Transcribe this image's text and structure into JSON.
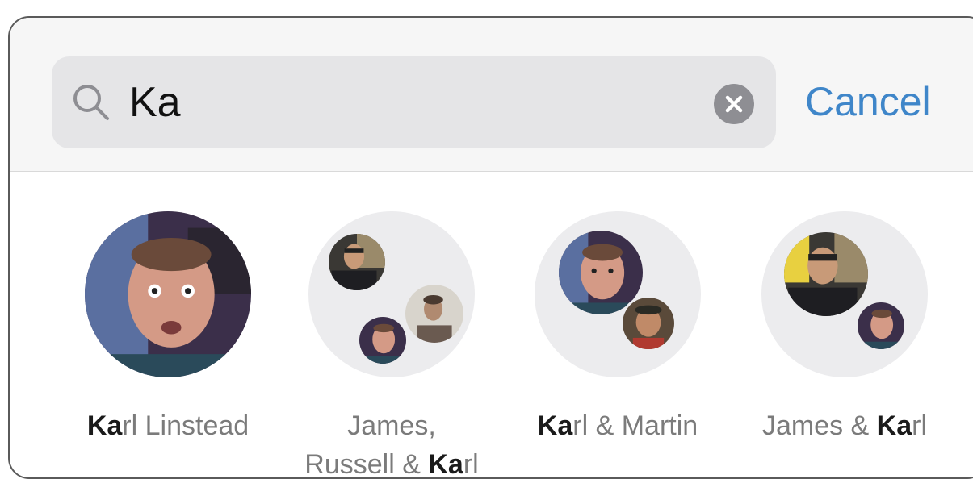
{
  "search": {
    "query": "Ka",
    "cancel_label": "Cancel"
  },
  "results": [
    {
      "match": "Ka",
      "rest": "rl Linstead"
    },
    {
      "line1": "James,",
      "prefix": "Russell & ",
      "match": "Ka",
      "rest": "rl"
    },
    {
      "match": "Ka",
      "rest": "rl & Martin"
    },
    {
      "prefix": "James & ",
      "match": "Ka",
      "rest": "rl"
    }
  ],
  "colors": {
    "accent": "#3f86c9",
    "search_field": "#e5e5e7",
    "clear_button": "#8e8e93"
  }
}
